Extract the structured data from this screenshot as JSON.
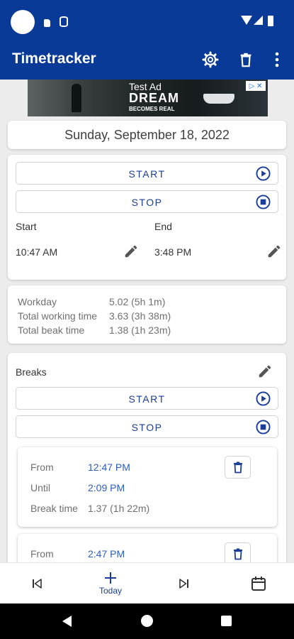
{
  "app": {
    "title": "Timetracker"
  },
  "colors": {
    "primary": "#0a3a98",
    "accent": "#1b3d9a",
    "link": "#2b5cc7"
  },
  "toolbar": {
    "icons": [
      "settings-icon",
      "delete-icon",
      "more-vert-icon"
    ]
  },
  "ad": {
    "title": "Test Ad",
    "headline": "DREAM",
    "subline": "BECOMES REAL",
    "badge": "▷ ✕"
  },
  "date": "Sunday, September 18, 2022",
  "work": {
    "start_button": "START",
    "stop_button": "STOP",
    "start_label": "Start",
    "end_label": "End",
    "start_time": "10:47 AM",
    "end_time": "3:48 PM"
  },
  "summary": {
    "rows": [
      {
        "label": "Workday",
        "value": "5.02 (5h 1m)"
      },
      {
        "label": "Total working time",
        "value": "3.63 (3h 38m)"
      },
      {
        "label": "Total beak time",
        "value": "1.38 (1h 23m)"
      }
    ]
  },
  "breaks": {
    "title": "Breaks",
    "start_button": "START",
    "stop_button": "STOP",
    "from_label": "From",
    "until_label": "Until",
    "duration_label": "Break time",
    "items": [
      {
        "from": "12:47 PM",
        "until": "2:09 PM",
        "duration": "1.37 (1h 22m)"
      },
      {
        "from": "2:47 PM"
      }
    ]
  },
  "bottom_nav": {
    "today_label": "Today"
  }
}
